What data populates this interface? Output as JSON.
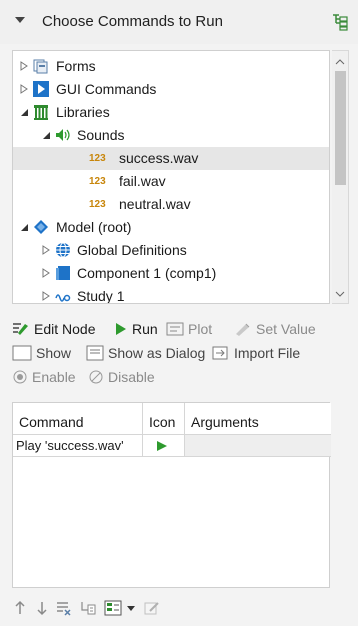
{
  "header": {
    "title": "Choose Commands to Run"
  },
  "tree": {
    "items": [
      {
        "label": "Forms"
      },
      {
        "label": "GUI Commands"
      },
      {
        "label": "Libraries"
      },
      {
        "label": "Sounds"
      },
      {
        "label": "success.wav",
        "badge": "123",
        "selected": true
      },
      {
        "label": "fail.wav",
        "badge": "123"
      },
      {
        "label": "neutral.wav",
        "badge": "123"
      },
      {
        "label": "Model (root)"
      },
      {
        "label": "Global Definitions"
      },
      {
        "label": "Component 1 (comp1)"
      },
      {
        "label": "Study 1"
      }
    ]
  },
  "toolbar": {
    "edit_node": "Edit Node",
    "run": "Run",
    "plot": "Plot",
    "set_value": "Set Value",
    "show": "Show",
    "show_as_dialog": "Show as Dialog",
    "import_file": "Import File",
    "enable": "Enable",
    "disable": "Disable"
  },
  "table": {
    "columns": [
      "Command",
      "Icon",
      "Arguments"
    ],
    "rows": [
      {
        "command": "Play 'success.wav'",
        "icon": "play-icon",
        "arguments": ""
      }
    ]
  },
  "colors": {
    "accent_blue": "#1e73c8",
    "play_green": "#2e9a2e",
    "badge_orange": "#c8860b"
  }
}
